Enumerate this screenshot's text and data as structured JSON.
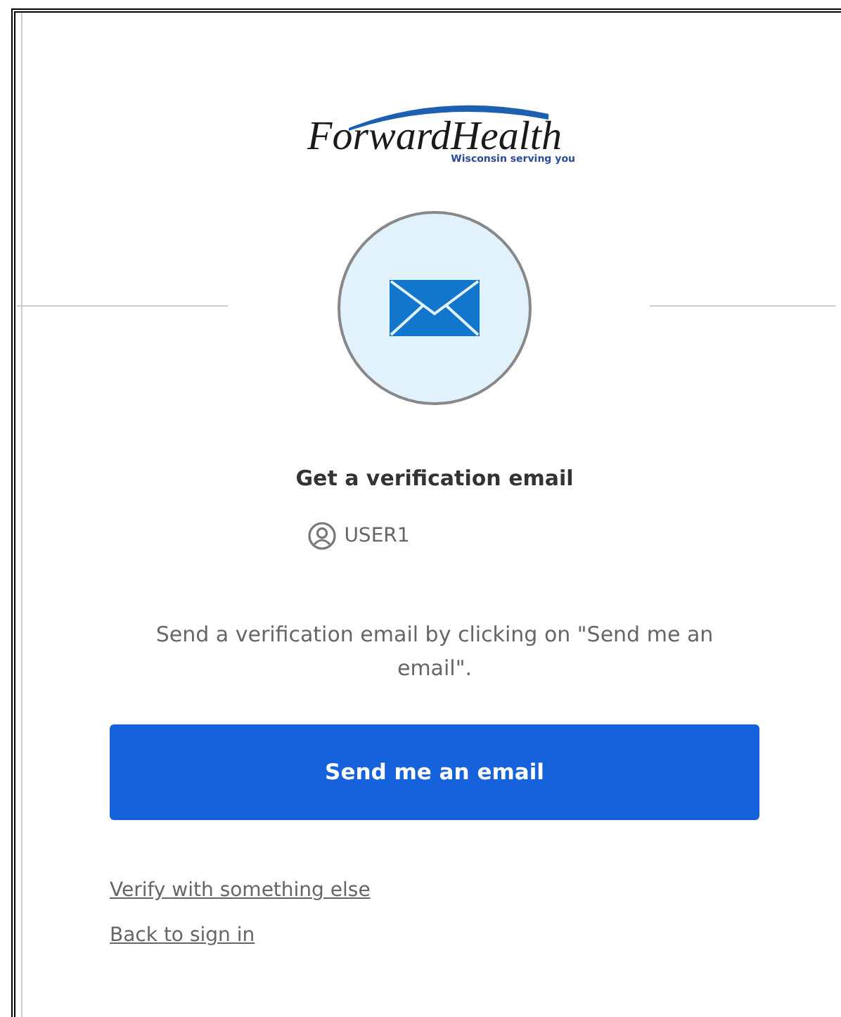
{
  "logo": {
    "name": "ForwardHealth",
    "tagline": "Wisconsin serving you"
  },
  "title": "Get a verification email",
  "user": "USER1",
  "instructions": "Send a verification email by clicking on \"Send me an email\".",
  "primary_button": "Send me an email",
  "links": [
    "Verify with something else",
    "Back to sign in"
  ]
}
